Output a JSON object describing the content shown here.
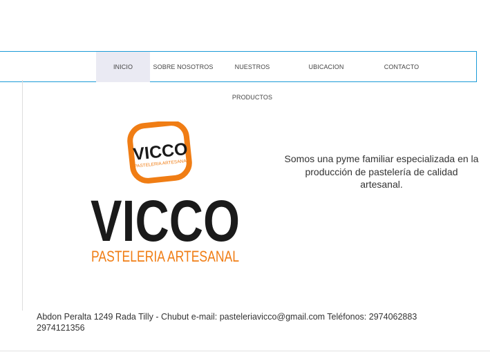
{
  "nav": {
    "items": [
      {
        "label": "INICIO",
        "active": true
      },
      {
        "label": "SOBRE NOSOTROS"
      },
      {
        "label": "NUESTROS PRODUCTOS"
      },
      {
        "label": "UBICACION"
      },
      {
        "label": "CONTACTO"
      }
    ]
  },
  "logo": {
    "badge_text": "VICCO",
    "badge_subtext": "PASTELERIA ARTESANAL",
    "main_text": "VICCO",
    "sub_text": "PASTELERIA ARTESANAL",
    "colors": {
      "orange": "#f07d14",
      "black": "#1a1a1a"
    }
  },
  "tagline": "Somos una pyme familiar especializada en la producción de pastelería de calidad artesanal.",
  "footer": {
    "text": "Abdon Peralta 1249 Rada Tilly - Chubut e-mail: pasteleriavicco@gmail.com Teléfonos: 2974062883 2974121356"
  },
  "colors": {
    "nav_border": "#1a9bd7",
    "active_bg": "#eaeaf3"
  }
}
